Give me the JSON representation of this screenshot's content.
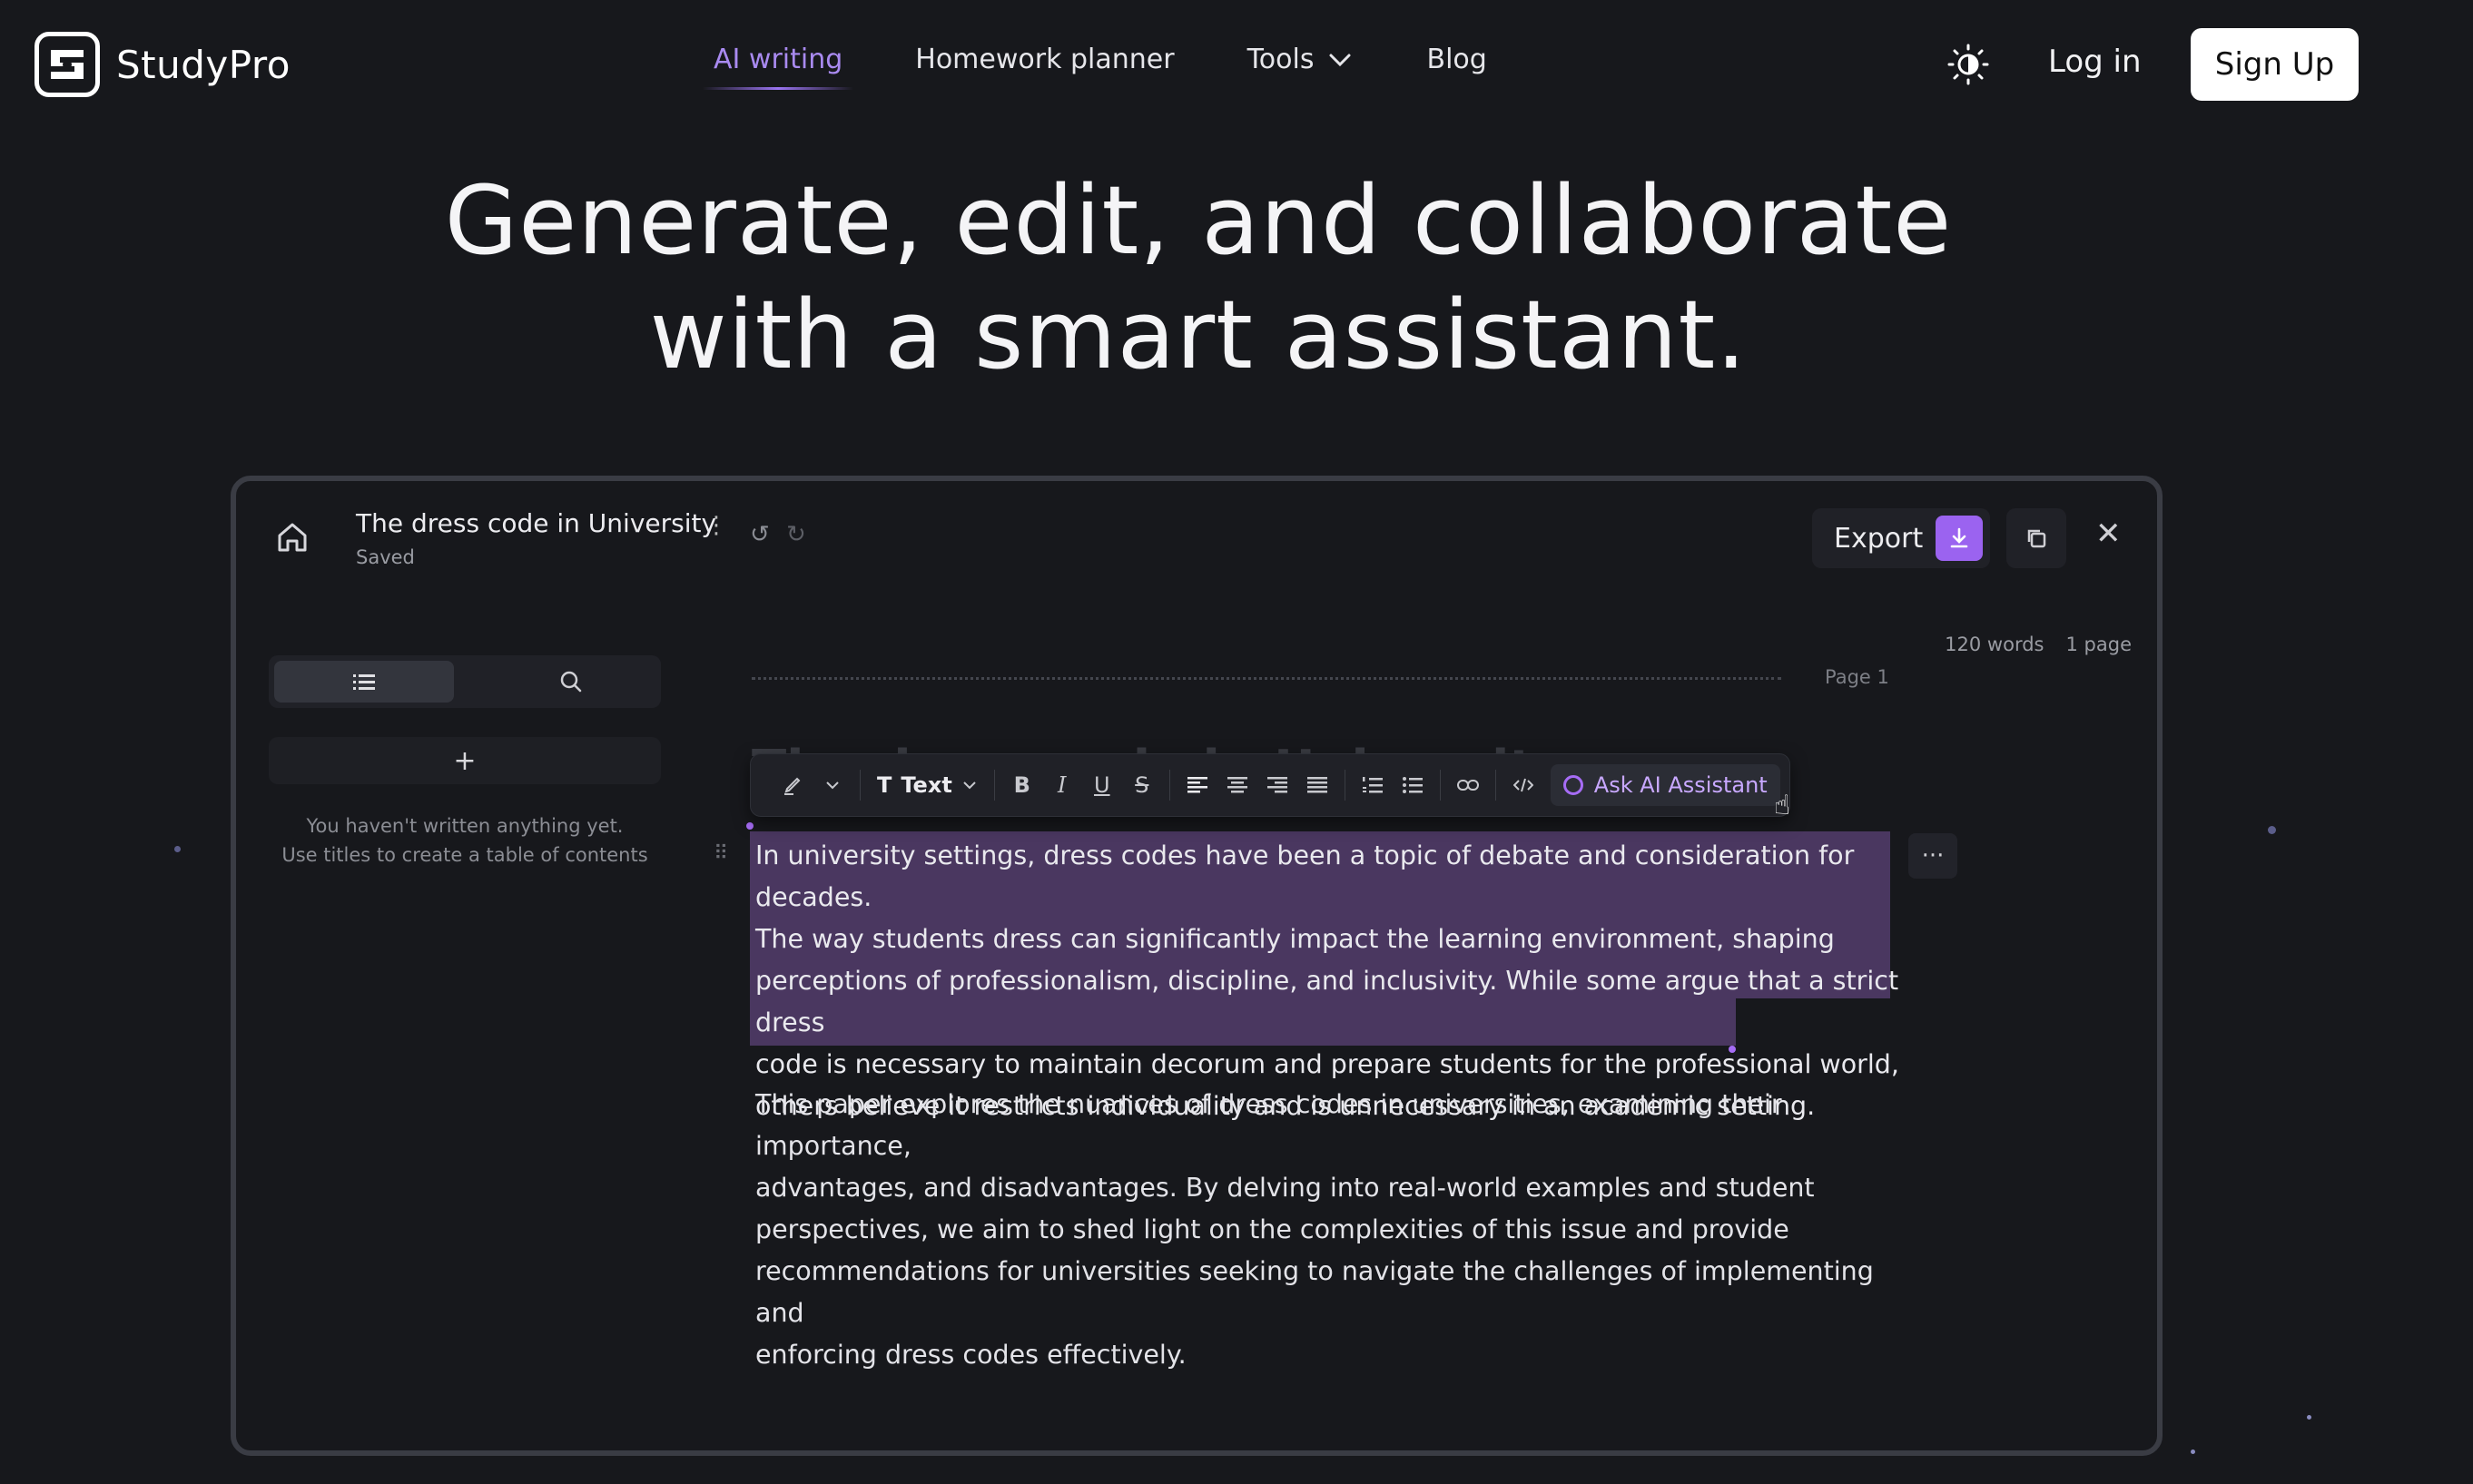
{
  "brand": {
    "name": "StudyPro"
  },
  "nav": {
    "items": [
      {
        "label": "AI writing",
        "active": true
      },
      {
        "label": "Homework planner",
        "active": false
      },
      {
        "label": "Tools",
        "active": false,
        "has_dropdown": true
      },
      {
        "label": "Blog",
        "active": false
      }
    ],
    "login_label": "Log in",
    "signup_label": "Sign Up"
  },
  "hero": {
    "line1": "Generate, edit, and collaborate",
    "line2": "with a smart assistant."
  },
  "editor": {
    "doc_title": "The dress code in University",
    "save_status": "Saved",
    "export_label": "Export",
    "word_count": "120 words",
    "page_count": "1 page",
    "page_label": "Page 1",
    "ghost_heading": "The dress code in University",
    "sidebar": {
      "empty_line1": "You haven't written anything yet.",
      "empty_line2": "Use titles to create a table of contents"
    },
    "toolbar": {
      "text_style": "Text",
      "ask_ai_label": "Ask AI Assistant"
    },
    "paragraphs": [
      "In university settings, dress codes have been a topic of debate and consideration for decades.\nThe way students dress can significantly impact the learning environment, shaping\nperceptions of professionalism, discipline, and inclusivity. While some argue that a strict dress\ncode is necessary to maintain decorum and prepare students for the professional world,\nothers believe it restricts individuality and is unnecessary in an academic setting.",
      "This paper explores the nuances of dress codes in universities, examining their importance,\nadvantages, and disadvantages. By delving into real-world examples and student\nperspectives, we aim to shed light on the complexities of this issue and provide\nrecommendations for universities seeking to navigate the challenges of implementing and\nenforcing dress codes effectively."
    ]
  },
  "colors": {
    "background": "#17181c",
    "accent": "#9b63f0",
    "nav_active": "#a98af0",
    "selection": "#4a3760"
  },
  "icons": [
    "logo-icon",
    "theme-toggle-icon",
    "chevron-down-icon",
    "home-icon",
    "more-vertical-icon",
    "undo-icon",
    "redo-icon",
    "download-icon",
    "copy-icon",
    "close-icon",
    "list-icon",
    "search-icon",
    "plus-icon",
    "highlighter-icon",
    "bold-icon",
    "italic-icon",
    "underline-icon",
    "strikethrough-icon",
    "align-left-icon",
    "align-center-icon",
    "align-right-icon",
    "align-justify-icon",
    "ordered-list-icon",
    "bullet-list-icon",
    "link-icon",
    "code-icon",
    "ai-icon",
    "drag-handle-icon",
    "more-horizontal-icon",
    "pointer-cursor-icon"
  ]
}
